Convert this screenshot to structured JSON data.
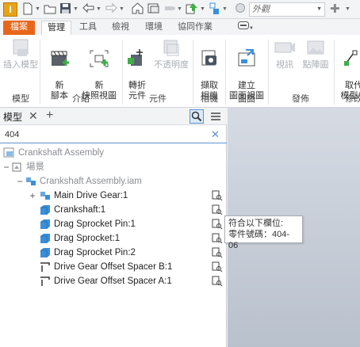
{
  "qat": {
    "appearance": "外觀"
  },
  "tabs": [
    {
      "label": "檔案"
    },
    {
      "label": "管理"
    },
    {
      "label": "工具"
    },
    {
      "label": "檢視"
    },
    {
      "label": "環境"
    },
    {
      "label": "協同作業"
    }
  ],
  "ribbon": {
    "buttons": [
      {
        "label": "插入模型"
      },
      {
        "label": "新\n腳本"
      },
      {
        "label": "新\n快照視圖"
      },
      {
        "label": "轉折\n元件"
      },
      {
        "label": "不透明度"
      },
      {
        "label": "擷取\n相機"
      },
      {
        "label": "建立\n圖面視圖"
      },
      {
        "label": "視訊"
      },
      {
        "label": "點陣圖"
      },
      {
        "label": "取代\n模型參"
      }
    ],
    "groups": [
      {
        "label": "模型"
      },
      {
        "label": "介紹"
      },
      {
        "label": "元件"
      },
      {
        "label": "相機"
      },
      {
        "label": "圖面"
      },
      {
        "label": "發佈"
      },
      {
        "label": "修改"
      }
    ]
  },
  "browser": {
    "tab_label": "模型",
    "search_value": "404",
    "tree": [
      {
        "label": "Crankshaft Assembly"
      },
      {
        "label": "場景"
      },
      {
        "label": "Crankshaft Assembly.iam"
      },
      {
        "label": "Main Drive Gear:1"
      },
      {
        "label": "Crankshaft:1"
      },
      {
        "label": "Drag Sprocket Pin:1"
      },
      {
        "label": "Drag Sprocket:1"
      },
      {
        "label": "Drag Sprocket Pin:2"
      },
      {
        "label": "Drive Gear Offset Spacer B:1"
      },
      {
        "label": "Drive Gear Offset Spacer A:1"
      }
    ]
  },
  "tooltip": {
    "line1": "符合以下欄位:",
    "line2": "零件號碼：404-06"
  },
  "colors": {
    "accent_orange": "#e8661b",
    "selection_blue": "#5b93d3",
    "part_blue": "#3a8fd9"
  }
}
